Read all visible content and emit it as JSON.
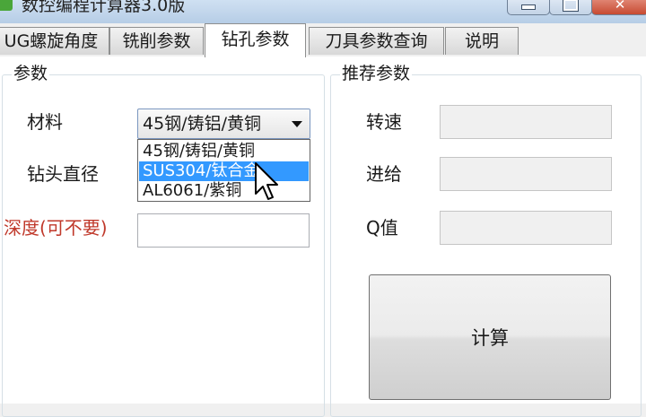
{
  "window": {
    "title": "数控编程计算器3.0版"
  },
  "tabs": [
    {
      "label": "UG螺旋角度",
      "active": false
    },
    {
      "label": "铣削参数",
      "active": false
    },
    {
      "label": "钻孔参数",
      "active": true
    },
    {
      "label": "刀具参数查询",
      "active": false
    },
    {
      "label": "说明",
      "active": false
    }
  ],
  "params_group": {
    "legend": "参数",
    "material_label": "材料",
    "material_selected": "45钢/铸铝/黄铜",
    "material_options": [
      "45钢/铸铝/黄铜",
      "SUS304/钛合金",
      "AL6061/紫铜"
    ],
    "highlighted_option_index": 1,
    "drill_diameter_label": "钻头直径",
    "depth_label": "深度(可不要)",
    "depth_value": ""
  },
  "recommend_group": {
    "legend": "推荐参数",
    "speed_label": "转速",
    "speed_value": "",
    "feed_label": "进给",
    "feed_value": "",
    "q_label": "Q值",
    "q_value": "",
    "calc_button": "计算"
  },
  "colors": {
    "highlight": "#3399ff",
    "depth_label": "#c0392b",
    "close_button": "#c74a32"
  }
}
